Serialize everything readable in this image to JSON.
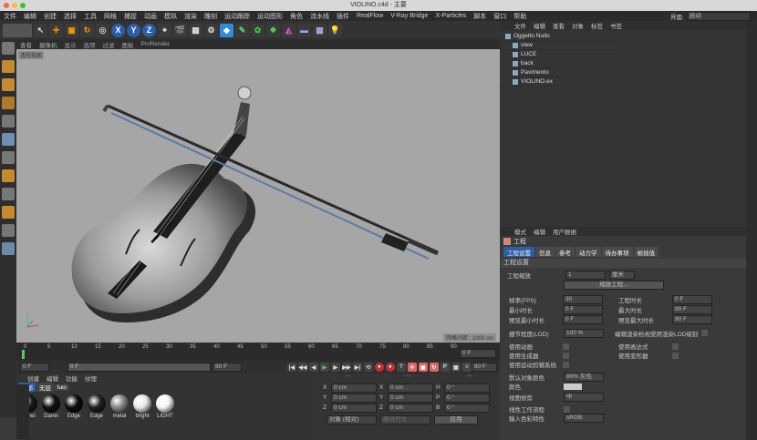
{
  "window": {
    "title": "VIOLINO.c4d - 主要"
  },
  "menu": [
    "文件",
    "编辑",
    "创建",
    "选择",
    "工具",
    "网格",
    "捕捉",
    "动画",
    "模拟",
    "渲染",
    "雕刻",
    "运动跟踪",
    "运动图形",
    "角色",
    "流水线",
    "插件",
    "RealFlow",
    "V-Ray Bridge",
    "X-Particles",
    "脚本",
    "窗口",
    "帮助"
  ],
  "layout": {
    "label": "界面:",
    "value": "启动"
  },
  "viewport": {
    "menu": [
      "查看",
      "摄像机",
      "显示",
      "选项",
      "过滤",
      "面板",
      "ProRender"
    ],
    "camera_label": "透视视图",
    "grid_label": "网格间距 : 1000 cm"
  },
  "timeline": {
    "ticks": [
      "0",
      "5",
      "10",
      "15",
      "20",
      "25",
      "30",
      "35",
      "40",
      "45",
      "50",
      "55",
      "60",
      "65",
      "70",
      "75",
      "80",
      "85",
      "90"
    ],
    "frame_readout": "0 F"
  },
  "transport": {
    "start": "0 F",
    "current": "0 F",
    "end": "90 F",
    "end2": "90 F"
  },
  "materials": {
    "menu": [
      "创建",
      "编辑",
      "功能",
      "纹理"
    ],
    "filters": [
      "全部",
      "无层",
      "luci"
    ],
    "items": [
      {
        "name": "Danei",
        "color": "#1a1a1a"
      },
      {
        "name": "Danei",
        "color": "#111"
      },
      {
        "name": "Edge",
        "color": "#0d0d0d"
      },
      {
        "name": "Edge",
        "color": "#202020"
      },
      {
        "name": "metal",
        "color": "#888"
      },
      {
        "name": "bright",
        "color": "#e8e8e8"
      },
      {
        "name": "LIGHT",
        "color": "#f5f5f5"
      }
    ]
  },
  "coords": {
    "headers": [
      "---",
      "---",
      "---"
    ],
    "rows": [
      {
        "a": "X",
        "av": "0 cm",
        "b": "X",
        "bv": "0 cm",
        "c": "H",
        "cv": "0 °"
      },
      {
        "a": "Y",
        "av": "0 cm",
        "b": "Y",
        "bv": "0 cm",
        "c": "P",
        "cv": "0 °"
      },
      {
        "a": "Z",
        "av": "0 cm",
        "b": "Z",
        "bv": "0 cm",
        "c": "B",
        "cv": "0 °"
      }
    ],
    "mode": "对象 (相对)",
    "size_mode": "绝对尺寸",
    "apply": "应用"
  },
  "objects": {
    "menu": [
      "文件",
      "编辑",
      "查看",
      "对象",
      "标签",
      "书签"
    ],
    "items": [
      {
        "name": "Oggetto Nullo",
        "indent": 0
      },
      {
        "name": "view",
        "indent": 1
      },
      {
        "name": "LUCE",
        "indent": 1
      },
      {
        "name": "back",
        "indent": 1
      },
      {
        "name": "Pavimento",
        "indent": 1
      },
      {
        "name": "VIOLINO.ex",
        "indent": 1
      }
    ]
  },
  "attributes": {
    "menu": [
      "模式",
      "编辑",
      "用户数据"
    ],
    "title": "工程",
    "tabs": [
      "工程设置",
      "信息",
      "参考",
      "动力学",
      "待办事项",
      "帧插值"
    ],
    "section": "工程设置",
    "scale_label": "工程缩放",
    "scale_value": "1",
    "scale_unit": "厘米",
    "scale_button": "缩放工程...",
    "left_fields": [
      {
        "label": "帧率(FPS)",
        "value": "30"
      },
      {
        "label": "最小时长",
        "value": "0 F"
      },
      {
        "label": "预览最小时长",
        "value": "0 F"
      }
    ],
    "right_fields": [
      {
        "label": "工程时长",
        "value": "0 F"
      },
      {
        "label": "最大时长",
        "value": "90 F"
      },
      {
        "label": "预览最大时长",
        "value": "90 F"
      }
    ],
    "lod_label": "细节程度(LOD)",
    "lod_value": "100 %",
    "lod_check": "编辑渲染检视使用渲染LOD级别",
    "checks_left": [
      "使用动画",
      "使用生成器",
      "使用运动剪辑系统"
    ],
    "checks_right": [
      "使用表达式",
      "使用变形器"
    ],
    "default_color_label": "默认对象颜色",
    "default_color_value": "80% 灰色",
    "color_label": "颜色",
    "view_clip_label": "视图修剪",
    "view_clip_value": "中",
    "linear_label": "线性工作流程",
    "input_color_label": "输入色彩特性",
    "input_color_value": "sRGB"
  }
}
